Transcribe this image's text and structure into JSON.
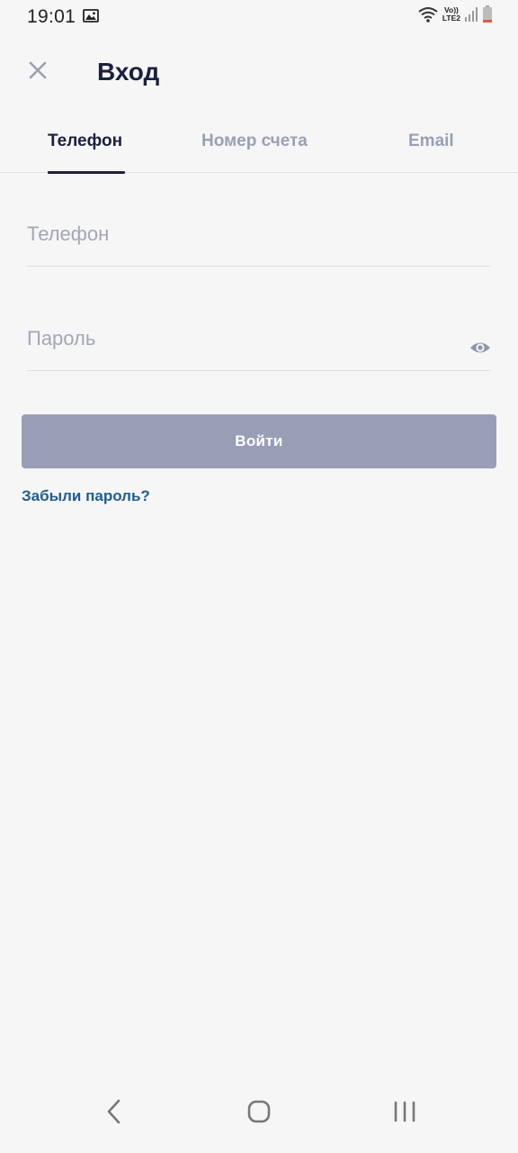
{
  "status_bar": {
    "time": "19:01",
    "network_label_top": "Vo))",
    "network_label_bottom": "LTE2",
    "icons": [
      "gallery-icon",
      "wifi-icon",
      "signal-icon",
      "battery-icon"
    ]
  },
  "header": {
    "title": "Вход",
    "close_icon": "close-icon"
  },
  "tabs": [
    {
      "label": "Телефон",
      "active": true
    },
    {
      "label": "Номер счета",
      "active": false
    },
    {
      "label": "Email",
      "active": false
    }
  ],
  "form": {
    "phone_placeholder": "Телефон",
    "phone_value": "",
    "password_placeholder": "Пароль",
    "password_value": "",
    "password_toggle_icon": "eye-icon",
    "submit_label": "Войти",
    "forgot_label": "Забыли пароль?"
  },
  "nav_bar": {
    "icons": [
      "back-icon",
      "home-icon",
      "recent-apps-icon"
    ]
  },
  "colors": {
    "background": "#f6f6f7",
    "primary_dark": "#1c2040",
    "inactive_tab": "#9aa0b4",
    "button_disabled": "#999eb6",
    "link": "#1f5c92",
    "placeholder": "#a3a7b3"
  }
}
